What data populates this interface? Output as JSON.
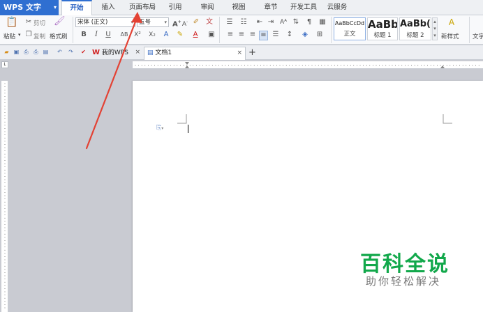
{
  "app": {
    "title": "WPS 文字"
  },
  "menu": {
    "tabs": [
      "开始",
      "插入",
      "页面布局",
      "引用",
      "审阅",
      "视图",
      "章节",
      "开发工具",
      "云服务"
    ]
  },
  "ribbon": {
    "paste": "粘贴",
    "cut": "剪切",
    "copy": "复制",
    "format_painter": "格式刷",
    "font_name": "宋体 (正文)",
    "font_size": "五号",
    "styles": [
      {
        "preview": "AaBbCcDd",
        "name": "正文"
      },
      {
        "preview": "AaBb",
        "name": "标题 1"
      },
      {
        "preview": "AaBb(",
        "name": "标题 2"
      }
    ],
    "new_style": "新样式",
    "text_tools": "文字"
  },
  "doc_tabs": [
    {
      "label": "我的WPS",
      "close": "×"
    },
    {
      "label": "文档1",
      "close": "×"
    }
  ],
  "new_tab": "+",
  "watermark": {
    "title": "百科全说",
    "subtitle": "助你轻松解决"
  },
  "colors": {
    "accent": "#2f6fd1",
    "arrow": "#e34234",
    "watermark": "#12a84b"
  }
}
